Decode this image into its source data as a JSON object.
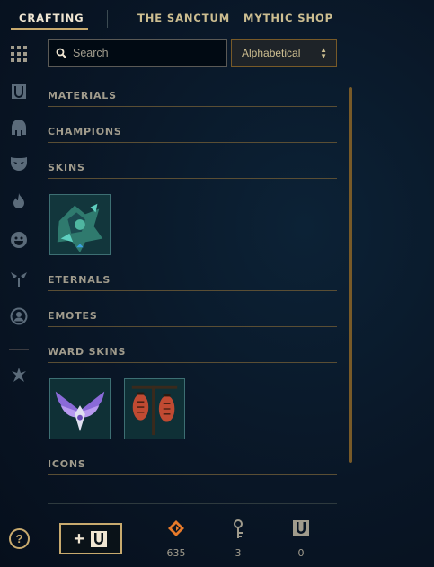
{
  "nav": {
    "tabs": [
      {
        "label": "CRAFTING",
        "active": true
      },
      {
        "label": "THE SANCTUM",
        "active": false
      },
      {
        "label": "MYTHIC SHOP",
        "active": false
      }
    ]
  },
  "sidebar": {
    "icons": [
      "grid-icon",
      "chest-icon",
      "champion-helmet-icon",
      "skin-mask-icon",
      "flame-icon",
      "emote-face-icon",
      "ward-icon",
      "profile-icon",
      "rune-icon"
    ]
  },
  "search": {
    "placeholder": "Search",
    "value": ""
  },
  "sort": {
    "selected": "Alphabetical"
  },
  "categories": {
    "materials": "MATERIALS",
    "champions": "CHAMPIONS",
    "skins": "SKINS",
    "eternals": "ETERNALS",
    "emotes": "EMOTES",
    "ward_skins": "WARD SKINS",
    "icons": "ICONS"
  },
  "items": {
    "skins": [
      {
        "name": "skin-shard"
      }
    ],
    "ward_skins": [
      {
        "name": "winged-ward-skin"
      },
      {
        "name": "lantern-ward-skin"
      }
    ]
  },
  "footer": {
    "help_label": "?",
    "add_plus": "+",
    "currencies": [
      {
        "icon": "orange-essence-icon",
        "value": "635",
        "color": "#e87a2a"
      },
      {
        "icon": "key-icon",
        "value": "3",
        "color": "#a09b8c"
      },
      {
        "icon": "chest-icon",
        "value": "0",
        "color": "#a09b8c"
      }
    ]
  },
  "colors": {
    "gold": "#c8aa6e",
    "accent_orange": "#e87a2a",
    "text": "#a09b8c"
  }
}
